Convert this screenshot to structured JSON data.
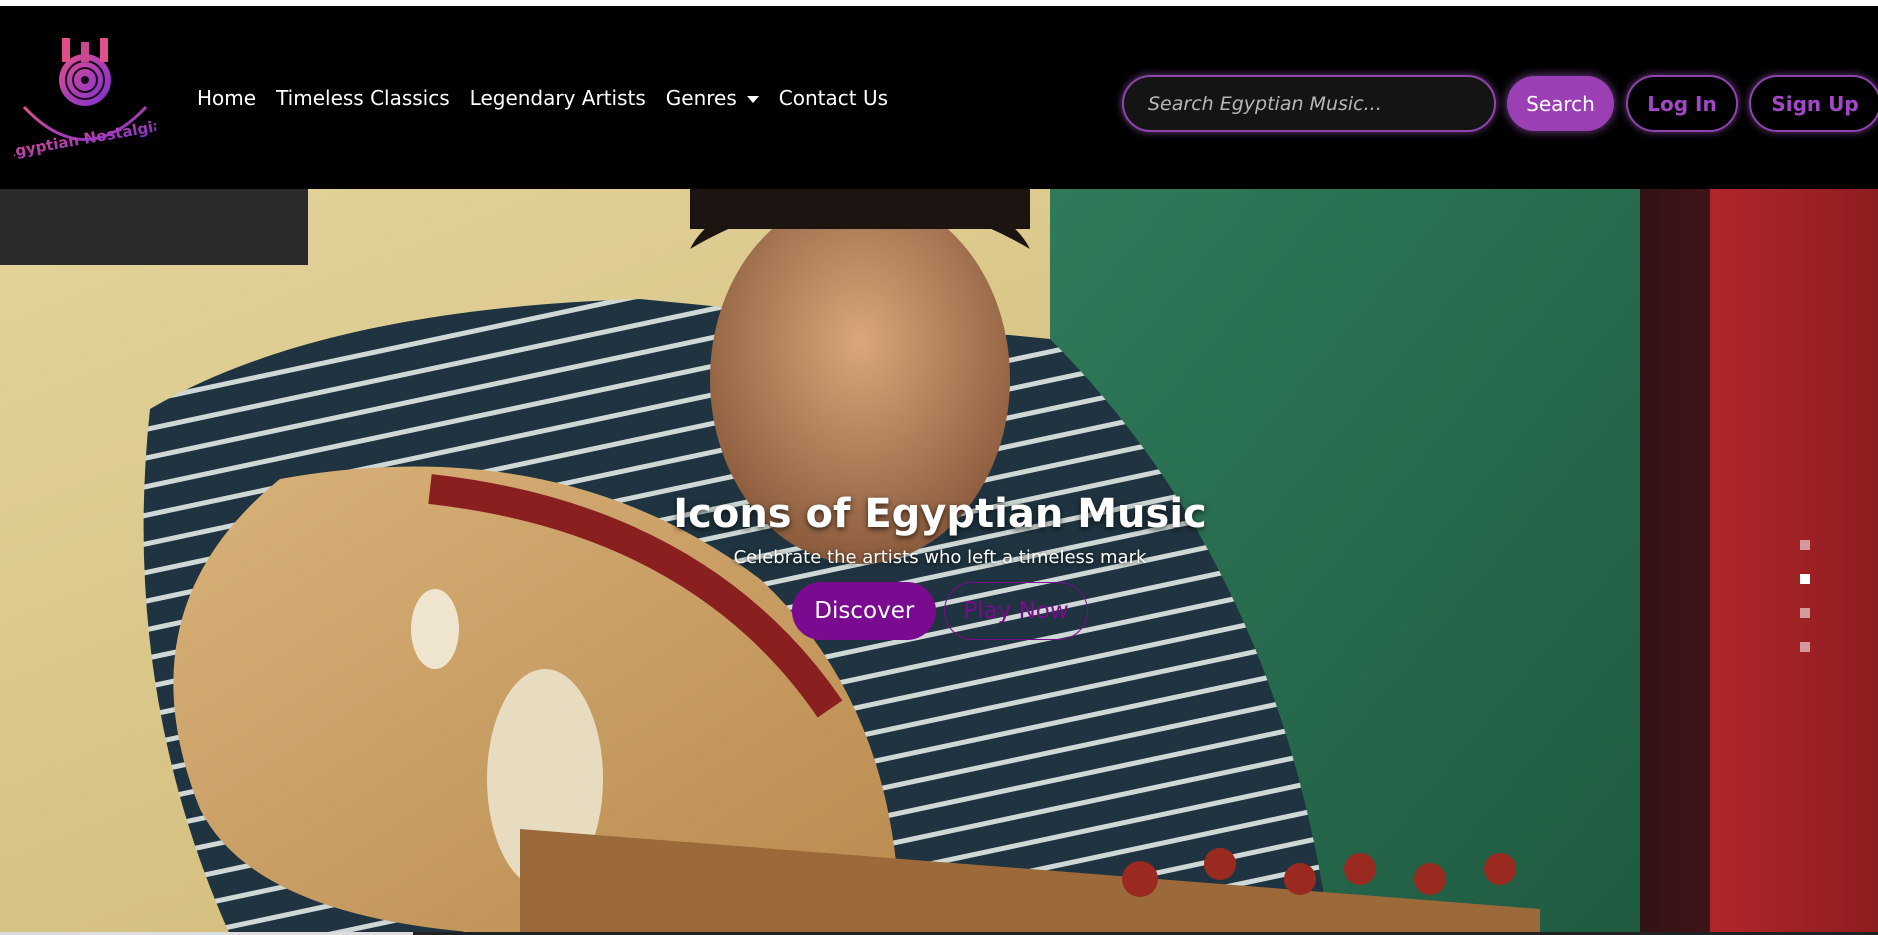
{
  "brand": {
    "name": "Egyptian Nostalgia",
    "accent": "#9b3fb5",
    "icon": "vinyl-logo-icon"
  },
  "nav": {
    "items": [
      {
        "label": "Home"
      },
      {
        "label": "Timeless Classics"
      },
      {
        "label": "Legendary Artists"
      },
      {
        "label": "Genres",
        "dropdown": true
      },
      {
        "label": "Contact Us"
      }
    ]
  },
  "search": {
    "placeholder": "Search Egyptian Music...",
    "button_label": "Search"
  },
  "auth": {
    "login_label": "Log In",
    "signup_label": "Sign Up"
  },
  "hero": {
    "title": "Icons of Egyptian Music",
    "subtitle": "Celebrate the artists who left a timeless mark",
    "primary_label": "Discover",
    "secondary_label": "Play Now",
    "slides_count": 4,
    "active_slide": 2,
    "progress": 0.22
  },
  "colors": {
    "button_primary": "#7a0a8f",
    "outline": "#8e44ad"
  }
}
